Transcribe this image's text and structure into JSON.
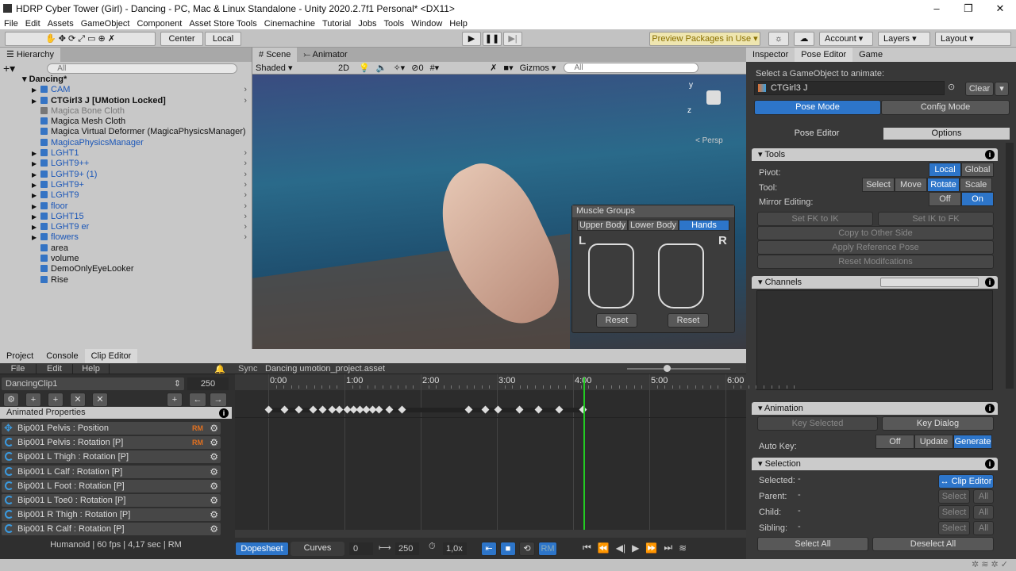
{
  "window": {
    "title": "HDRP Cyber Tower (Girl) - Dancing - PC, Mac & Linux Standalone - Unity 2020.2.7f1 Personal* <DX11>"
  },
  "menu": [
    "File",
    "Edit",
    "Assets",
    "GameObject",
    "Component",
    "Asset Store Tools",
    "Cinemachine",
    "Tutorial",
    "Jobs",
    "Tools",
    "Window",
    "Help"
  ],
  "toolbar": {
    "center": "Center",
    "local": "Local",
    "preview_packages": "Preview Packages in Use",
    "account": "Account",
    "layers": "Layers",
    "layout": "Layout"
  },
  "hierarchy": {
    "tab": "Hierarchy",
    "search_placeholder": "All",
    "scene": "Dancing*",
    "items": [
      {
        "label": "CAM",
        "style": "blue",
        "depth": 1,
        "arrow": true
      },
      {
        "label": "CTGirl3 J [UMotion Locked]",
        "style": "bold",
        "depth": 1,
        "arrow": true
      },
      {
        "label": "Magica Bone Cloth",
        "style": "grey",
        "depth": 1
      },
      {
        "label": "Magica Mesh Cloth",
        "style": "normal",
        "depth": 1
      },
      {
        "label": "Magica Virtual Deformer (MagicaPhysicsManager)",
        "style": "normal",
        "depth": 1
      },
      {
        "label": "MagicaPhysicsManager",
        "style": "blue",
        "depth": 1
      },
      {
        "label": "LGHT1",
        "style": "blue",
        "depth": 1,
        "arrow": true
      },
      {
        "label": "LGHT9++",
        "style": "blue",
        "depth": 1,
        "arrow": true
      },
      {
        "label": "LGHT9+ (1)",
        "style": "blue",
        "depth": 1,
        "arrow": true
      },
      {
        "label": "LGHT9+",
        "style": "blue",
        "depth": 1,
        "arrow": true
      },
      {
        "label": "LGHT9",
        "style": "blue",
        "depth": 1,
        "arrow": true
      },
      {
        "label": "floor",
        "style": "blue",
        "depth": 1,
        "arrow": true
      },
      {
        "label": "LGHT15",
        "style": "blue",
        "depth": 1,
        "arrow": true
      },
      {
        "label": "LGHT9 er",
        "style": "blue",
        "depth": 1,
        "arrow": true
      },
      {
        "label": "flowers",
        "style": "blue",
        "depth": 1,
        "arrow": true
      },
      {
        "label": "area",
        "style": "normal",
        "depth": 1
      },
      {
        "label": "volume",
        "style": "normal",
        "depth": 1
      },
      {
        "label": "DemoOnlyEyeLooker",
        "style": "normal",
        "depth": 1
      },
      {
        "label": "Rise",
        "style": "normal",
        "depth": 1
      }
    ]
  },
  "scene": {
    "tabs": [
      "Scene",
      "Animator"
    ],
    "shading": "Shaded",
    "mode_2d": "2D",
    "hidden_count": "0",
    "gizmos": "Gizmos",
    "search_placeholder": "All",
    "persp": "< Persp",
    "axis_y": "y",
    "axis_z": "z",
    "muscle": {
      "title": "Muscle Groups",
      "tabs": [
        "Upper Body",
        "Lower Body",
        "Hands"
      ],
      "active_tab": "Hands",
      "left": "L",
      "right": "R",
      "reset": "Reset"
    }
  },
  "right": {
    "tabs": [
      "Inspector",
      "Pose Editor",
      "Game"
    ],
    "select_label": "Select a GameObject to animate:",
    "target": "CTGirl3 J",
    "clear": "Clear",
    "modes": [
      "Pose Mode",
      "Config Mode"
    ],
    "subtabs": [
      "Pose Editor",
      "Options"
    ],
    "tools": {
      "title": "Tools",
      "pivot": "Pivot:",
      "pivot_opts": [
        "Local",
        "Global"
      ],
      "tool": "Tool:",
      "tool_opts": [
        "Select",
        "Move",
        "Rotate",
        "Scale"
      ],
      "mirror": "Mirror Editing:",
      "mirror_opts": [
        "Off",
        "On"
      ],
      "set_fk": "Set FK to IK",
      "set_ik": "Set IK to FK",
      "copy": "Copy to Other Side",
      "apply": "Apply Reference Pose",
      "reset": "Reset Modifcations"
    },
    "channels": {
      "title": "Channels"
    },
    "animation": {
      "title": "Animation",
      "key_selected": "Key Selected",
      "key_dialog": "Key Dialog",
      "auto_key": "Auto Key:",
      "auto_opts": [
        "Off",
        "Update",
        "Generate"
      ]
    },
    "selection": {
      "title": "Selection",
      "selected": "Selected:",
      "parent": "Parent:",
      "child": "Child:",
      "sibling": "Sibling:",
      "dash": "-",
      "clip_editor": "↔ Clip Editor",
      "select": "Select",
      "all": "All",
      "select_all": "Select All",
      "deselect_all": "Deselect All"
    }
  },
  "bottom": {
    "tabs": [
      "Project",
      "Console",
      "Clip Editor"
    ],
    "menu": [
      "File",
      "Edit",
      "Help"
    ],
    "sync": "Sync",
    "project": "Dancing umotion_project.asset",
    "clip": "DancingClip1",
    "clip_length": "250",
    "animated_properties": "Animated Properties",
    "properties": [
      {
        "label": "Bip001 Pelvis : Position",
        "rm": "RM",
        "icon": "move"
      },
      {
        "label": "Bip001 Pelvis : Rotation [P]",
        "rm": "RM",
        "icon": "rotate"
      },
      {
        "label": "Bip001 L Thigh : Rotation [P]",
        "icon": "rotate"
      },
      {
        "label": "Bip001 L Calf : Rotation [P]",
        "icon": "rotate"
      },
      {
        "label": "Bip001 L Foot : Rotation [P]",
        "icon": "rotate"
      },
      {
        "label": "Bip001 L Toe0 : Rotation [P]",
        "icon": "rotate"
      },
      {
        "label": "Bip001 R Thigh : Rotation [P]",
        "icon": "rotate"
      },
      {
        "label": "Bip001 R Calf : Rotation [P]",
        "icon": "rotate"
      }
    ],
    "info": "Humanoid | 60 fps | 4,17 sec | RM",
    "timeline": {
      "ticks": [
        "0:00",
        "1:00",
        "2:00",
        "3:00",
        "4:00",
        "5:00",
        "6:00"
      ],
      "keyframes": [
        0,
        13,
        24,
        35,
        43,
        50,
        56,
        62,
        67,
        72,
        77,
        82,
        87,
        95,
        105,
        158,
        171,
        181,
        198,
        213,
        229,
        248
      ],
      "playhead": 248
    },
    "dopesheet": "Dopesheet",
    "curves": "Curves",
    "start": "0",
    "end": "250",
    "speed": "1,0x",
    "rm": "RM"
  },
  "colors": {
    "accent": "#2d75c9",
    "playhead": "#22cc22",
    "rm": "#e07020"
  }
}
